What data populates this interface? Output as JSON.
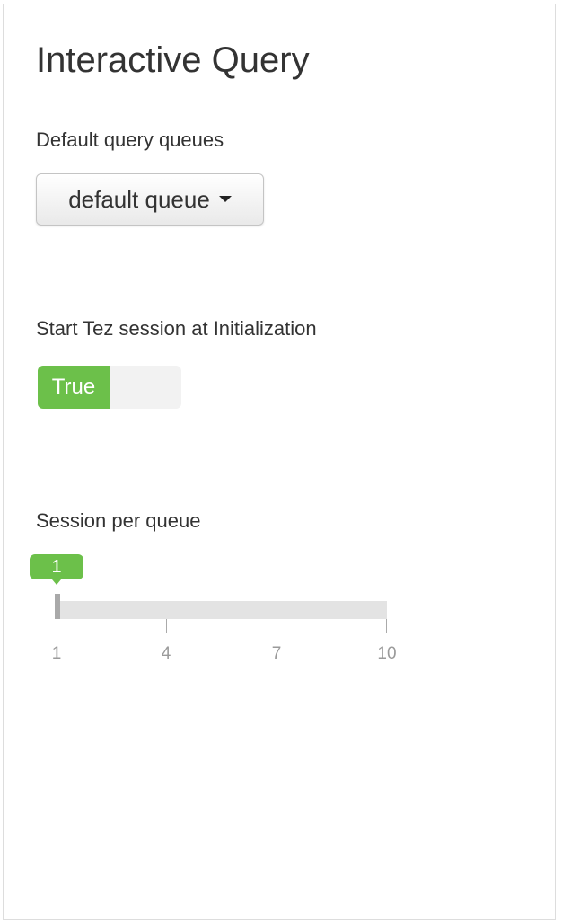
{
  "panel": {
    "title": "Interactive Query"
  },
  "query_queues": {
    "label": "Default query queues",
    "selected": "default queue"
  },
  "tez_session": {
    "label": "Start Tez session at Initialization",
    "value": "True",
    "on_color": "#6cc04a"
  },
  "session_per_queue": {
    "label": "Session per queue",
    "value": "1",
    "min": 1,
    "max": 10,
    "ticks": [
      "1",
      "4",
      "7",
      "10"
    ]
  }
}
